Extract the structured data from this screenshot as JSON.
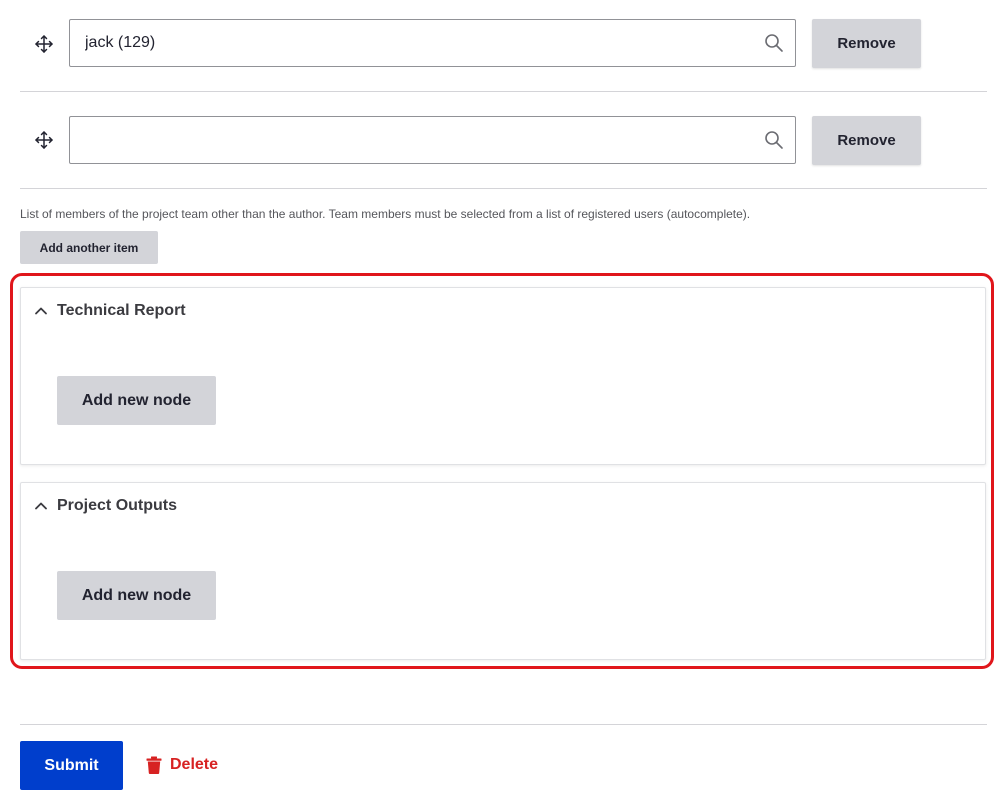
{
  "team_members": {
    "items": [
      {
        "value": "jack (129)",
        "remove_label": "Remove"
      },
      {
        "value": "",
        "remove_label": "Remove"
      }
    ],
    "description": "List of members of the project team other than the author. Team members must be selected from a list of registered users (autocomplete).",
    "add_another_label": "Add another item"
  },
  "sections": [
    {
      "title": "Technical Report",
      "expanded": true,
      "add_node_label": "Add new node"
    },
    {
      "title": "Project Outputs",
      "expanded": true,
      "add_node_label": "Add new node"
    }
  ],
  "actions": {
    "submit_label": "Submit",
    "delete_label": "Delete"
  },
  "colors": {
    "primary": "#003ecc",
    "danger": "#d72222",
    "highlight": "#e0161b",
    "button_bg": "#d3d4d9"
  },
  "icons": {
    "drag": "move-arrows-icon",
    "search": "magnifier-icon",
    "collapse": "chevron-up-icon",
    "delete": "trash-icon"
  }
}
